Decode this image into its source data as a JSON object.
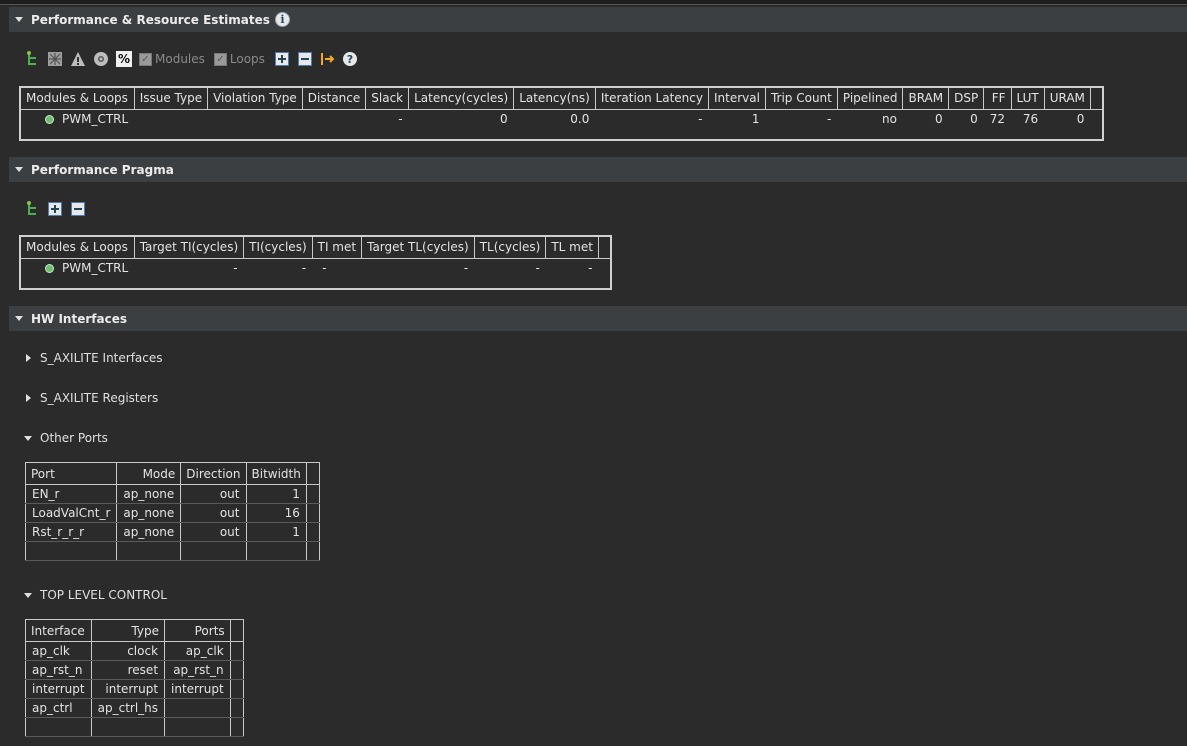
{
  "sections": {
    "perf_estimates": "Performance & Resource Estimates",
    "perf_pragma": "Performance Pragma",
    "hw_interfaces": "HW Interfaces"
  },
  "toolbar": {
    "modules_label": "Modules",
    "loops_label": "Loops",
    "percent_label": "%",
    "help_label": "?"
  },
  "perf_table": {
    "headers": [
      "Modules & Loops",
      "Issue Type",
      "Violation Type",
      "Distance",
      "Slack",
      "Latency(cycles)",
      "Latency(ns)",
      "Iteration Latency",
      "Interval",
      "Trip Count",
      "Pipelined",
      "BRAM",
      "DSP",
      "FF",
      "LUT",
      "URAM"
    ],
    "row": [
      "PWM_CTRL",
      "",
      "",
      "",
      "-",
      "0",
      "0.0",
      "-",
      "1",
      "-",
      "no",
      "0",
      "0",
      "72",
      "76",
      "0"
    ]
  },
  "pragma_table": {
    "headers": [
      "Modules & Loops",
      "Target TI(cycles)",
      "TI(cycles)",
      "TI met",
      "Target TL(cycles)",
      "TL(cycles)",
      "TL met"
    ],
    "row": [
      "PWM_CTRL",
      "-",
      "-",
      "-",
      "-",
      "-",
      "-"
    ]
  },
  "subsections": {
    "s_axilite_interfaces": "S_AXILITE Interfaces",
    "s_axilite_registers": "S_AXILITE Registers",
    "other_ports": "Other Ports",
    "top_level_control": "TOP LEVEL CONTROL"
  },
  "ports_table": {
    "headers": [
      "Port",
      "Mode",
      "Direction",
      "Bitwidth"
    ],
    "rows": [
      [
        "EN_r",
        "ap_none",
        "out",
        "1"
      ],
      [
        "LoadValCnt_r",
        "ap_none",
        "out",
        "16"
      ],
      [
        "Rst_r_r_r",
        "ap_none",
        "out",
        "1"
      ],
      [
        "",
        "",
        "",
        ""
      ]
    ]
  },
  "control_table": {
    "headers": [
      "Interface",
      "Type",
      "Ports"
    ],
    "rows": [
      [
        "ap_clk",
        "clock",
        "ap_clk"
      ],
      [
        "ap_rst_n",
        "reset",
        "ap_rst_n"
      ],
      [
        "interrupt",
        "interrupt",
        "interrupt"
      ],
      [
        "ap_ctrl",
        "ap_ctrl_hs",
        ""
      ],
      [
        "",
        "",
        ""
      ]
    ]
  },
  "icons": [
    "tree-icon",
    "resource-icon",
    "warning-icon",
    "gear-icon",
    "percent-icon",
    "expand-all-icon",
    "collapse-all-icon",
    "goto-source-icon",
    "help-icon"
  ],
  "colors": {
    "background": "#2b2b2b",
    "section_bar": "#3c3f41",
    "status_dot": "#6fbf6f",
    "border": "#c8c8c8"
  }
}
